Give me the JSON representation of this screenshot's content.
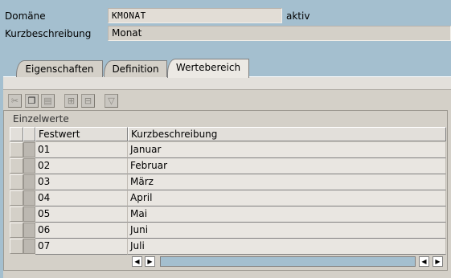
{
  "header": {
    "domain_label": "Domäne",
    "domain_value": "KMONAT",
    "domain_status": "aktiv",
    "desc_label": "Kurzbeschreibung",
    "desc_value": "Monat"
  },
  "tabs": [
    {
      "label": "Eigenschaften",
      "active": false
    },
    {
      "label": "Definition",
      "active": false
    },
    {
      "label": "Wertebereich",
      "active": true
    }
  ],
  "toolbar": {
    "icons": [
      "scissors-icon",
      "copy-icon",
      "paste-icon",
      "insert-row-icon",
      "delete-row-icon",
      "filter-icon"
    ]
  },
  "table": {
    "title": "Einzelwerte",
    "columns": [
      "Festwert",
      "Kurzbeschreibung"
    ],
    "rows": [
      {
        "festwert": "01",
        "kurz": "Januar"
      },
      {
        "festwert": "02",
        "kurz": "Februar"
      },
      {
        "festwert": "03",
        "kurz": "März"
      },
      {
        "festwert": "04",
        "kurz": "April"
      },
      {
        "festwert": "05",
        "kurz": "Mai"
      },
      {
        "festwert": "06",
        "kurz": "Juni"
      },
      {
        "festwert": "07",
        "kurz": "Juli"
      }
    ]
  }
}
